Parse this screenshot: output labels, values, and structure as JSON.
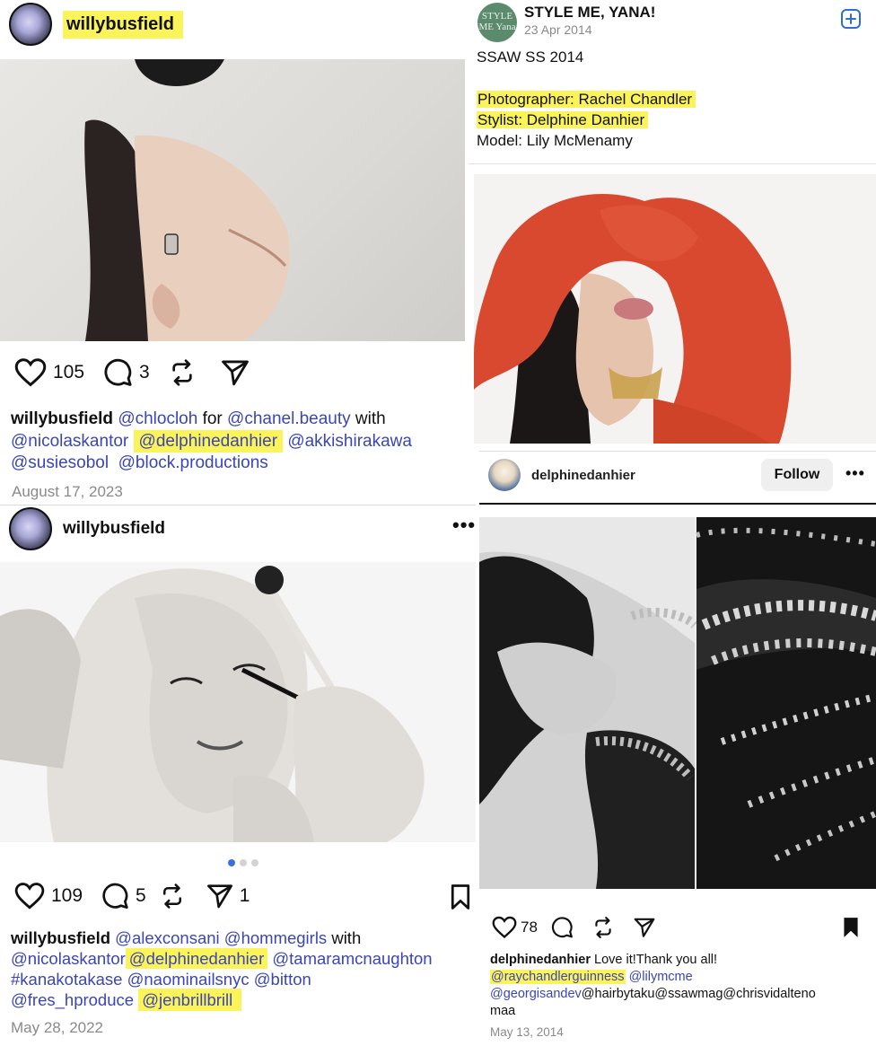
{
  "post1": {
    "username": "willybusfield",
    "likes": "105",
    "comments": "3",
    "caption_user": "willybusfield",
    "caption_parts": [
      "@chlocloh",
      " for ",
      "@chanel.beauty",
      " with"
    ],
    "mentions_line2": [
      "@nicolaskantor",
      "@delphinedanhier",
      "@akkishirakawa"
    ],
    "mentions_line3": [
      "@susiesobol",
      "@block.productions"
    ],
    "date": "August 17, 2023"
  },
  "post2": {
    "brand": "STYLE ME, YANA!",
    "logo_text": "STYLE ME Yana",
    "date": "23 Apr 2014",
    "title": "SSAW SS 2014",
    "photographer": "Photographer: Rachel Chandler",
    "stylist": "Stylist: Delphine Danhier",
    "model": "Model: Lily McMenamy",
    "add_icon": "plus-square-icon"
  },
  "post3": {
    "username": "willybusfield",
    "likes": "109",
    "comments": "5",
    "shares": "1",
    "caption_user": "willybusfield",
    "line1": [
      "@alexconsani",
      "@hommegirls",
      " with"
    ],
    "line2": [
      "@nicolaskantor",
      "@delphinedanhier",
      "@tamaramcnaughton"
    ],
    "line3": [
      "#kanakotakase",
      "@naominailsnyc",
      "@bitton"
    ],
    "line4": [
      "@fres_hproduce",
      "@jenbrillbrill"
    ],
    "date": "May 28, 2022"
  },
  "post4": {
    "username": "delphinedanhier",
    "follow_label": "Follow",
    "likes": "78",
    "caption_user": "delphinedanhier",
    "caption_text": "Love it!Thank you all!",
    "line2": [
      "@raychandlerguinness",
      "@lilymcme"
    ],
    "line3_a": "@georgisandev",
    "line3_b": "@hairbytaku@ssawmag@chrisvidalteno",
    "line4": "maa",
    "date": "May 13, 2014"
  },
  "colors": {
    "highlight": "#fbf35a",
    "mention": "#3a45b8",
    "date": "#8a8a8a"
  }
}
